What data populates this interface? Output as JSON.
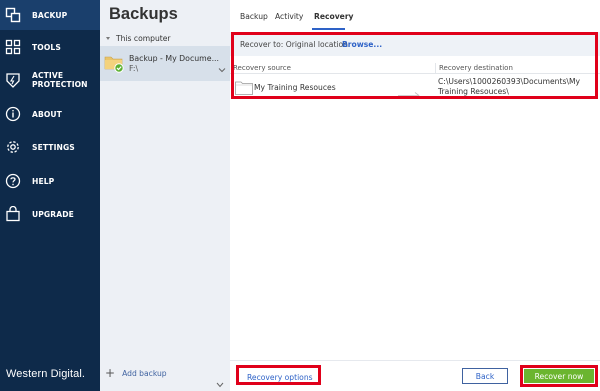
{
  "nav": {
    "items": [
      {
        "label": "BACKUP",
        "icon": "backup-icon"
      },
      {
        "label": "TOOLS",
        "icon": "tools-icon"
      },
      {
        "label": "ACTIVE\nPROTECTION",
        "icon": "shield-icon"
      },
      {
        "label": "ABOUT",
        "icon": "info-icon"
      },
      {
        "label": "SETTINGS",
        "icon": "gear-icon"
      },
      {
        "label": "HELP",
        "icon": "help-icon"
      },
      {
        "label": "UPGRADE",
        "icon": "cart-icon"
      }
    ],
    "logo": "Western Digital."
  },
  "backups": {
    "title": "Backups",
    "group": "This computer",
    "item": {
      "name": "Backup - My Docume...",
      "path": "F:\\"
    },
    "add_label": "Add backup"
  },
  "main": {
    "tabs": [
      {
        "label": "Backup",
        "active": false
      },
      {
        "label": "Activity",
        "active": false
      },
      {
        "label": "Recovery",
        "active": true
      }
    ],
    "recover_to": "Recover to:  Original location",
    "browse": "Browse...",
    "columns": {
      "source": "Recovery source",
      "destination": "Recovery destination"
    },
    "row": {
      "source": "My Training Resouces",
      "destination": "C:\\Users\\1000260393\\Documents\\My Training Resouces\\"
    },
    "buttons": {
      "options": "Recovery options",
      "back": "Back",
      "recover": "Recover now"
    }
  },
  "colors": {
    "nav_bg": "#0e2a4a",
    "nav_active": "#1a3f6c",
    "accent_blue": "#2e62c7",
    "recover_green": "#6bb52f",
    "highlight_red": "#e0001a"
  }
}
